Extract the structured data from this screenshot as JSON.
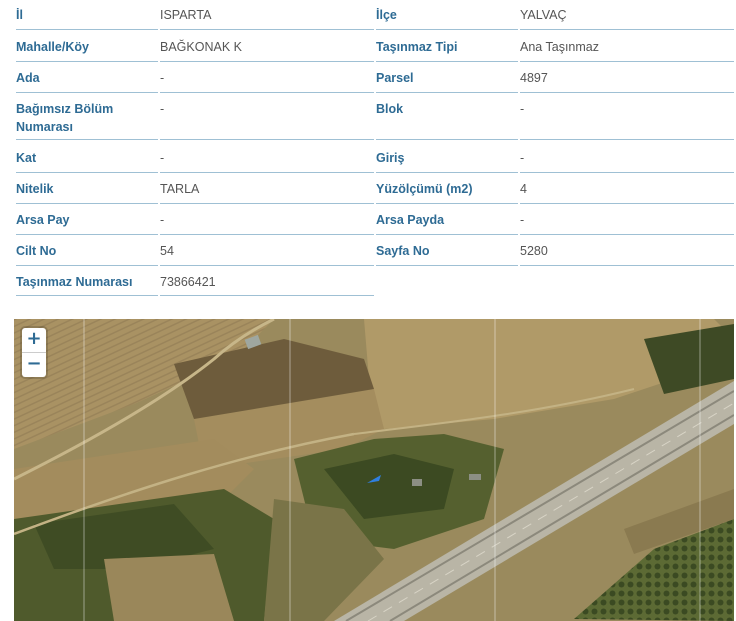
{
  "rows": [
    {
      "l_label": "İl",
      "l_value": "ISPARTA",
      "r_label": "İlçe",
      "r_value": "YALVAÇ"
    },
    {
      "l_label": "Mahalle/Köy",
      "l_value": "BAĞKONAK K",
      "r_label": "Taşınmaz Tipi",
      "r_value": "Ana Taşınmaz"
    },
    {
      "l_label": "Ada",
      "l_value": "-",
      "r_label": "Parsel",
      "r_value": "4897"
    },
    {
      "l_label": "Bağımsız Bölüm Numarası",
      "l_value": "-",
      "r_label": "Blok",
      "r_value": "-"
    },
    {
      "l_label": "Kat",
      "l_value": "-",
      "r_label": "Giriş",
      "r_value": "-"
    },
    {
      "l_label": "Nitelik",
      "l_value": "TARLA",
      "r_label": "Yüzölçümü (m2)",
      "r_value": "4"
    },
    {
      "l_label": "Arsa Pay",
      "l_value": "-",
      "r_label": "Arsa Payda",
      "r_value": "-"
    },
    {
      "l_label": "Cilt No",
      "l_value": "54",
      "r_label": "Sayfa No",
      "r_value": "5280"
    },
    {
      "l_label": "Taşınmaz Numarası",
      "l_value": "73866421"
    }
  ],
  "map": {
    "zoom_in_label": "+",
    "zoom_out_label": "−",
    "marker_color": "#2f7fe0"
  }
}
